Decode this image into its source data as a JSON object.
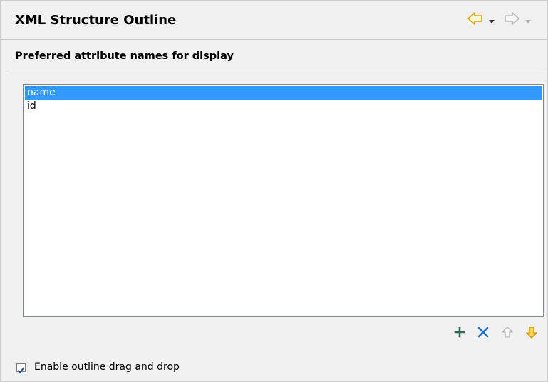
{
  "header": {
    "title": "XML Structure Outline",
    "nav": {
      "back_icon": "back-arrow-icon",
      "back_menu_icon": "dropdown-triangle-icon",
      "forward_icon": "forward-arrow-icon",
      "forward_menu_icon": "dropdown-triangle-icon"
    }
  },
  "section": {
    "title": "Preferred attribute names for display"
  },
  "list": {
    "items": [
      {
        "label": "name",
        "selected": true
      },
      {
        "label": "id",
        "selected": false
      }
    ]
  },
  "toolbar": {
    "add_icon": "plus-icon",
    "remove_icon": "x-remove-icon",
    "move_up_icon": "up-arrow-icon",
    "move_down_icon": "down-arrow-icon"
  },
  "options": {
    "drag_drop_label": "Enable outline drag and drop",
    "drag_drop_checked": true
  },
  "colors": {
    "selection": "#3399ff",
    "accent_yellow": "#e8b400",
    "accent_blue": "#1f6fd1"
  }
}
